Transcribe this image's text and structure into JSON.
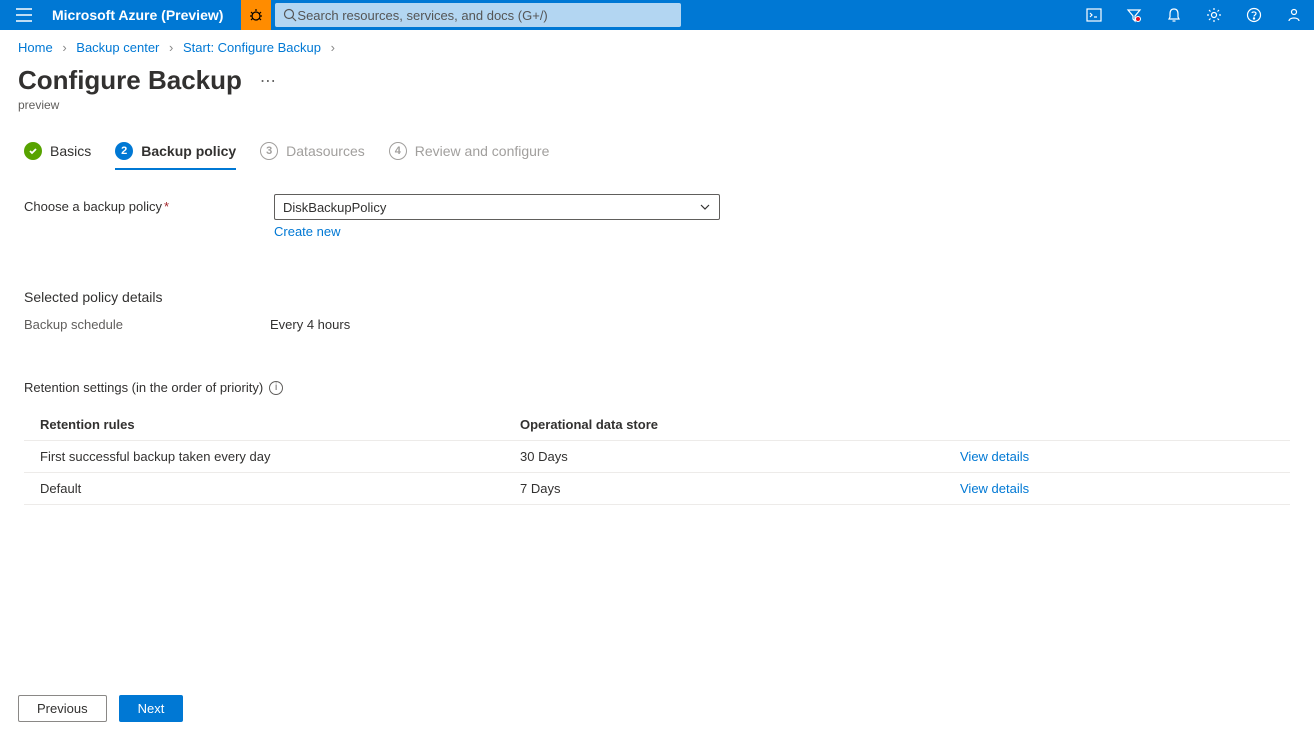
{
  "header": {
    "brand": "Microsoft Azure (Preview)",
    "search_placeholder": "Search resources, services, and docs (G+/)"
  },
  "breadcrumb": {
    "items": [
      "Home",
      "Backup center",
      "Start: Configure Backup"
    ]
  },
  "page": {
    "title": "Configure Backup",
    "subtitle": "preview"
  },
  "tabs": {
    "items": [
      {
        "label": "Basics",
        "state": "done"
      },
      {
        "label": "Backup policy",
        "num": "2",
        "state": "current"
      },
      {
        "label": "Datasources",
        "num": "3",
        "state": "pending"
      },
      {
        "label": "Review and configure",
        "num": "4",
        "state": "pending"
      }
    ]
  },
  "form": {
    "policy_label": "Choose a backup policy",
    "policy_value": "DiskBackupPolicy",
    "create_new": "Create new",
    "selected_details_heading": "Selected policy details",
    "schedule_label": "Backup schedule",
    "schedule_value": "Every 4 hours",
    "retention_heading": "Retention settings (in the order of priority)",
    "table": {
      "col_rules": "Retention rules",
      "col_store": "Operational data store",
      "rows": [
        {
          "rule": "First successful backup taken every day",
          "store": "30 Days",
          "action": "View details"
        },
        {
          "rule": "Default",
          "store": "7 Days",
          "action": "View details"
        }
      ]
    }
  },
  "footer": {
    "previous": "Previous",
    "next": "Next"
  }
}
